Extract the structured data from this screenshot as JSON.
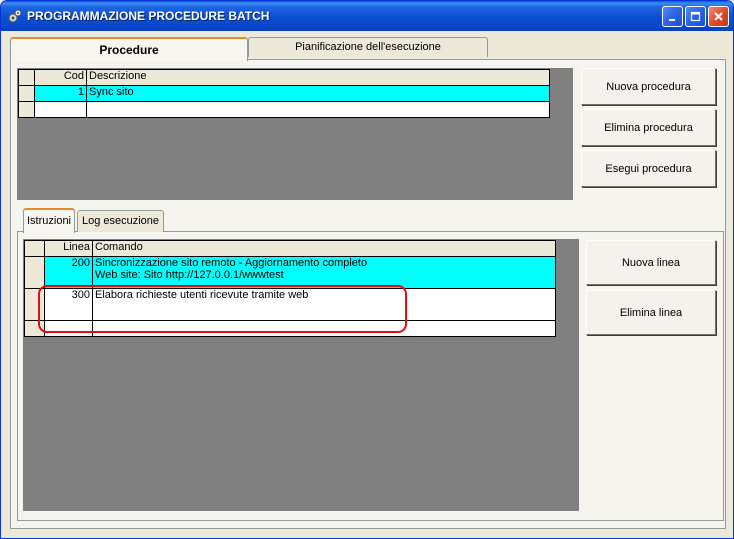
{
  "window": {
    "title": "PROGRAMMAZIONE PROCEDURE BATCH",
    "icon": "gears-icon",
    "controls": [
      "minimize-icon",
      "maximize-icon",
      "close-icon"
    ]
  },
  "tabs": [
    {
      "label": "Procedure",
      "active": true
    },
    {
      "label": "Pianificazione dell'esecuzione",
      "active": false
    }
  ],
  "procedures": {
    "columns": [
      "Cod",
      "Descrizione"
    ],
    "rows": [
      {
        "cod": "1",
        "descrizione": "Sync sito",
        "selected": true
      },
      {
        "cod": "",
        "descrizione": "",
        "selected": false
      }
    ]
  },
  "procedure_buttons": {
    "new": "Nuova procedura",
    "delete": "Elimina procedura",
    "run": "Esegui procedura"
  },
  "inner_tabs": [
    {
      "label": "Istruzioni",
      "active": true
    },
    {
      "label": "Log esecuzione",
      "active": false
    }
  ],
  "instructions": {
    "columns": [
      "Linea",
      "Comando"
    ],
    "rows": [
      {
        "linea": "200",
        "comando_line1": "Sincronizzazione sito remoto - Aggiornamento completo",
        "comando_line2": "Web site: Sito http://127.0.0.1/wwwtest",
        "selected": true
      },
      {
        "linea": "300",
        "comando_line1": "Elabora richieste utenti ricevute tramite web",
        "comando_line2": "",
        "selected": false
      },
      {
        "linea": "",
        "comando_line1": "",
        "comando_line2": "",
        "selected": false
      }
    ]
  },
  "instruction_buttons": {
    "new": "Nuova linea",
    "delete": "Elimina linea"
  },
  "colors": {
    "selection": "#00ffff",
    "highlight": "#e01010",
    "grid_background": "#808080"
  }
}
